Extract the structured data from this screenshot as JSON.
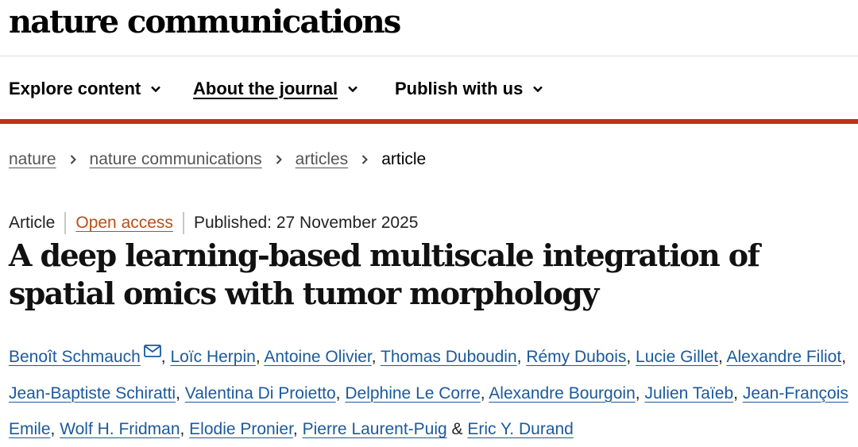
{
  "site": {
    "logo": "nature communications"
  },
  "nav": {
    "items": [
      {
        "label": "Explore content"
      },
      {
        "label": "About the journal"
      },
      {
        "label": "Publish with us"
      }
    ]
  },
  "breadcrumb": {
    "items": [
      "nature",
      "nature communications",
      "articles"
    ],
    "current": "article"
  },
  "article": {
    "type": "Article",
    "access": "Open access",
    "published": "Published: 27 November 2025",
    "title": "A deep learning-based multiscale integration of spatial omics with tumor morphology",
    "authors": [
      "Benoît Schmauch",
      "Loïc Herpin",
      "Antoine Olivier",
      "Thomas Duboudin",
      "Rémy Dubois",
      "Lucie Gillet",
      "Alexandre Filiot",
      "Jean-Baptiste Schiratti",
      "Valentina Di Proietto",
      "Delphine Le Corre",
      "Alexandre Bourgoin",
      "Julien Taïeb",
      "Jean-François Emile",
      "Wolf H. Fridman",
      "Elodie Pronier",
      "Pierre Laurent-Puig",
      "Eric Y. Durand"
    ],
    "authors_separator": ", ",
    "authors_last_joiner": " & "
  },
  "colors": {
    "accent_bar": "#c0301b",
    "open_access": "#b3501e",
    "author_link": "#1b5a9c"
  }
}
